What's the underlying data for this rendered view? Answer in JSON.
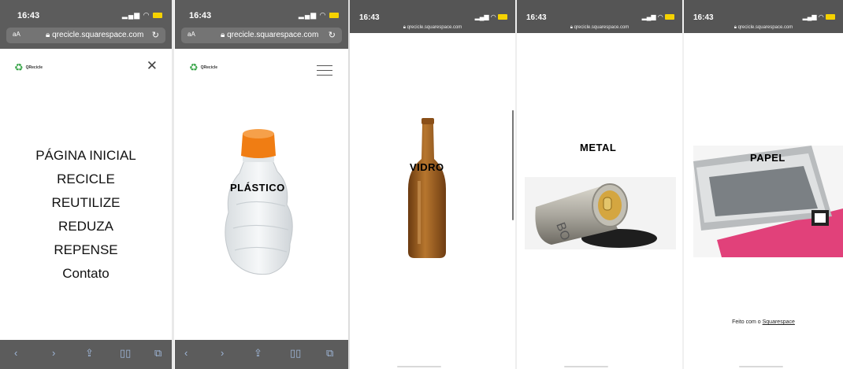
{
  "status": {
    "time": "16:43"
  },
  "browser": {
    "url": "qrecicle.squarespace.com",
    "aa_label": "aA",
    "mini_url": "qrecicle.squarespace.com"
  },
  "site": {
    "logo_name": "QRecicle",
    "menu": [
      "PÁGINA INICIAL",
      "RECICLE",
      "REUTILIZE",
      "REDUZA",
      "REPENSE",
      "Contato"
    ]
  },
  "materials": {
    "plastico": "PLÁSTICO",
    "vidro": "VIDRO",
    "metal": "METAL",
    "papel": "PAPEL"
  },
  "footer": {
    "made_with": "Feito com o",
    "brand": "Squarespace"
  },
  "colors": {
    "chrome_dark": "#5c5c5c",
    "logo_green": "#3aa64a",
    "bottle_cap": "#f07d13",
    "glass_amber": "#9a5b1f",
    "magazine_pink": "#e1417a"
  },
  "icons": [
    "lock-icon",
    "reload-icon",
    "close-icon",
    "hamburger-icon",
    "back-icon",
    "forward-icon",
    "share-icon",
    "bookmarks-icon",
    "tabs-icon",
    "recycle-logo-icon"
  ]
}
